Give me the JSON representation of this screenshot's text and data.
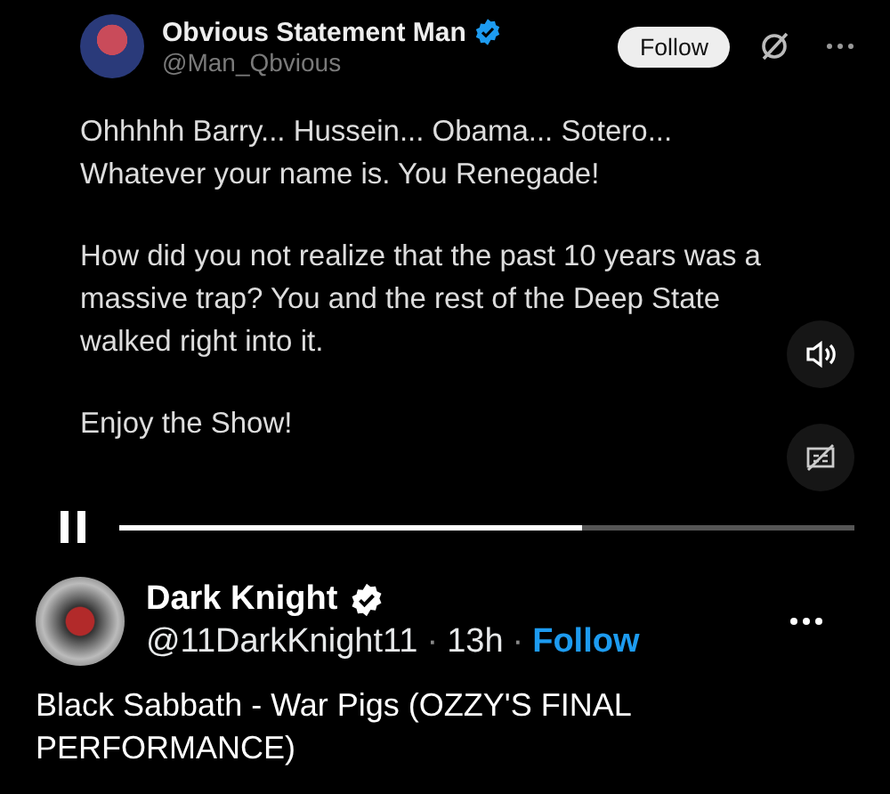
{
  "video": {
    "embedded_post": {
      "author": "Obvious Statement Man",
      "verified": true,
      "handle": "@Man_Qbvious",
      "follow_button": "Follow",
      "paragraphs": [
        "Ohhhhh Barry... Hussein... Obama... Sotero... Whatever your name is. You Renegade!",
        "How did you not realize that the past 10 years was a massive trap? You and the rest of the Deep State walked right into it.",
        "Enjoy the Show!"
      ]
    },
    "muted": false,
    "captions": false,
    "playing": true,
    "progress": {
      "level": 0.63
    }
  },
  "post": {
    "author": "Dark Knight",
    "verified": true,
    "handle": "@11DarkKnight11",
    "separator_1": "·",
    "time": "13h",
    "separator_2": "·",
    "follow": "Follow",
    "text": "Black Sabbath - War Pigs (OZZY'S FINAL PERFORMANCE)"
  }
}
